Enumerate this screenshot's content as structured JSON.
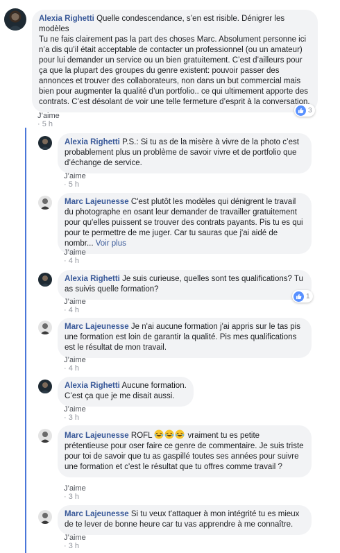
{
  "comments": [
    {
      "author": "Alexia Righetti",
      "text": " Quelle condescendance, s’en est risible. Dénigrer les modèles\nTu ne fais clairement pas la part des choses Marc. Absolument personne ici n’a dis qu’il était acceptable de contacter un professionnel (ou un amateur) pour lui demander un service ou un bien gratuitement. C’est d’ailleurs pour ça que la plupart des groupes du genre existent: pouvoir passer des annonces et trouver des collaborateurs, non dans un but commercial mais bien pour augmenter la qualité d’un portfolio.. ce qui ultimement apporte des contrats. C’est désolant de voir une telle fermeture d’esprit à la conversation.",
      "like_label": "J’aime",
      "time": "5 h",
      "reactions": "3"
    },
    {
      "author": "Alexia Righetti",
      "text": " P.S.: Si tu as de la misère à vivre de la photo c’est probablement plus un problème de savoir vivre et de portfolio que d’échange de service.",
      "like_label": "J’aime",
      "time": "5 h"
    },
    {
      "author": "Marc Lajeunesse",
      "text": " C'est plutôt les modèles qui dénigrent le travail du photographe en osant leur demander de travailler gratuitement pour qu'elles puissent se trouver des contrats payants. Pis tu es qui pour te permettre de me juger. Car tu sauras que j'ai aidé de nombr...",
      "see_more": "Voir plus",
      "like_label": "J’aime",
      "time": "4 h"
    },
    {
      "author": "Alexia Righetti",
      "text": " Je suis curieuse, quelles sont tes qualifications? Tu as suivis quelle formation?",
      "like_label": "J’aime",
      "time": "4 h",
      "reactions": "1"
    },
    {
      "author": "Marc Lajeunesse",
      "text": " Je n'ai aucune formation j'ai appris sur le tas pis une formation est loin de garantir la qualité. Pis mes qualifications est le résultat de mon travail.",
      "like_label": "J’aime",
      "time": "4 h"
    },
    {
      "author": "Alexia Righetti",
      "text": " Aucune formation.\nC’est ça que je me disait aussi.",
      "like_label": "J’aime",
      "time": "3 h"
    },
    {
      "author": "Marc Lajeunesse",
      "text_before": " ROFL ",
      "text": " vraiment tu es petite prétentieuse pour oser faire ce genre de commentaire. Je suis triste pour toi de savoir que tu as gaspillé toutes ses années pour suivre une formation et c'est le résultat que tu offres comme travail ?",
      "like_label": "J’aime",
      "time": "3 h"
    },
    {
      "author": "Marc Lajeunesse",
      "text": " Si tu veux t'attaquer à mon intégrité tu es mieux de te lever de bonne heure car tu vas apprendre à me connaître.",
      "like_label": "J’aime",
      "time": "3 h"
    }
  ],
  "separator": " · ",
  "colors": {
    "author": "#385898",
    "bubble": "#f2f3f5",
    "thread": "#4a76d9",
    "like_badge": "#5890ff"
  },
  "icons": {
    "like": "thumbs-up-icon",
    "emoji": "laughing-tears-emoji"
  }
}
